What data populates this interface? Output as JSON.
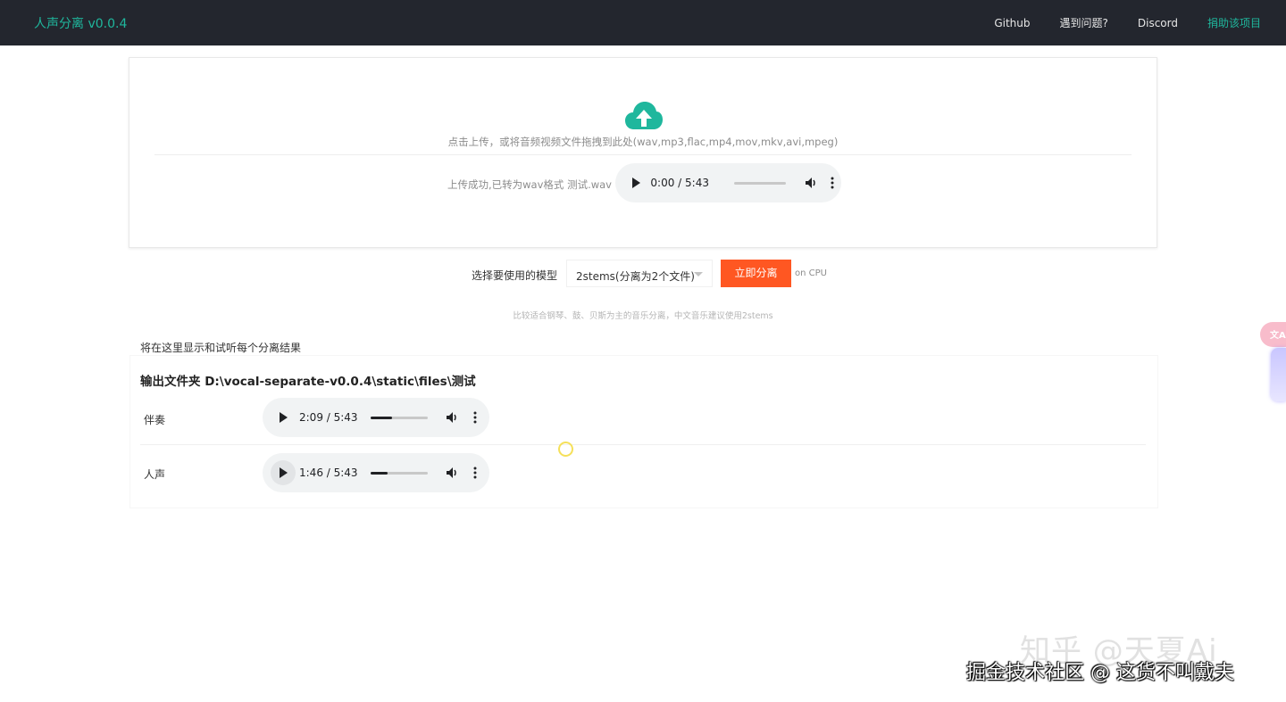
{
  "app": {
    "title": "人声分离 v0.0.4",
    "brand_color": "#1fb79d",
    "header_bg": "#23262e"
  },
  "nav": {
    "items": [
      {
        "label": "Github"
      },
      {
        "label": "遇到问题?"
      },
      {
        "label": "Discord"
      },
      {
        "label": "捐助该项目"
      }
    ]
  },
  "upload": {
    "icon": "cloud-upload-icon",
    "hint": "点击上传，或将音频视频文件拖拽到此处(wav,mp3,flac,mp4,mov,mkv,avi,mpeg)",
    "status": "上传成功,已转为wav格式 测试.wav",
    "player": {
      "time": "0:00 / 5:43",
      "progress": 0
    }
  },
  "model": {
    "label": "选择要使用的模型",
    "selected": "2stems(分离为2个文件)",
    "button": "立即分离",
    "button_color": "#ff5722",
    "device": "on CPU",
    "tip": "比较适合钢琴、鼓、贝斯为主的音乐分离，中文音乐建议使用2stems"
  },
  "results": {
    "title": "将在这里显示和试听每个分离结果",
    "output_folder": "输出文件夹 D:\\vocal-separate-v0.0.4\\static\\files\\测试",
    "tracks": [
      {
        "name": "伴奏",
        "time": "2:09 / 5:43",
        "progress": 0.376
      },
      {
        "name": "人声",
        "time": "1:46 / 5:43",
        "progress": 0.309
      }
    ]
  },
  "side": {
    "translate_label": "文A"
  },
  "watermarks": {
    "line1": "知乎 @天夏Ai",
    "line2": "掘金技术社区 @ 这货不叫戴夫"
  }
}
